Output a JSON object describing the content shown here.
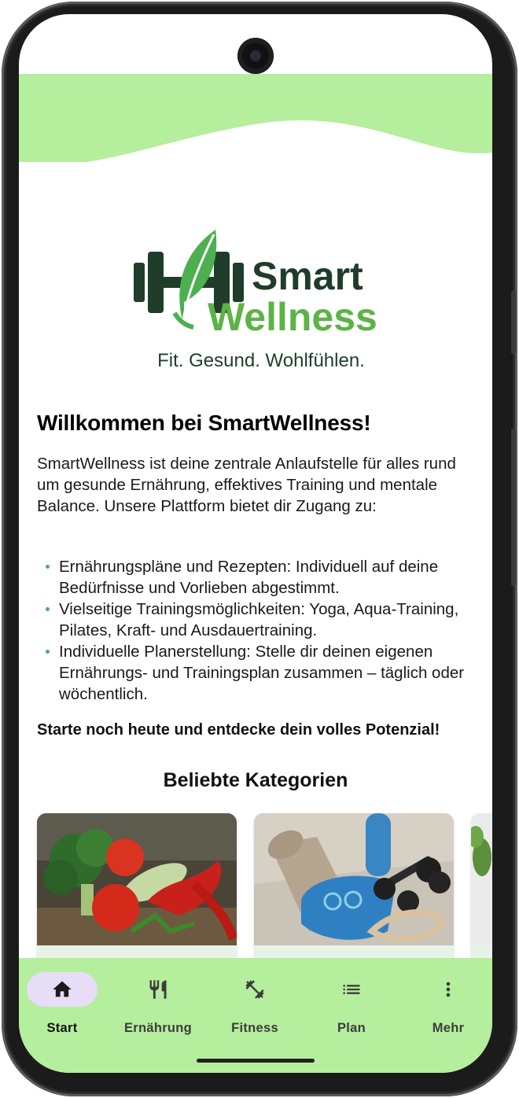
{
  "brand": {
    "name_line1": "Smart",
    "name_line2": "Wellness",
    "tagline": "Fit. Gesund. Wohlfühlen.",
    "colors": {
      "dark_green": "#1f3d2a",
      "leaf_green": "#4caf50",
      "light_green": "#b5ee9c"
    }
  },
  "welcome": {
    "title": "Willkommen bei SmartWellness!",
    "intro": "SmartWellness ist deine zentrale Anlaufstelle für alles rund um gesunde Ernährung, effektives Training und mentale Balance. Unsere Plattform bietet dir Zugang zu:",
    "bullets": [
      "Ernährungspläne und Rezepten: Individuell auf deine Bedürfnisse und Vorlieben abgestimmt.",
      "Vielseitige Trainingsmöglichkeiten: Yoga, Aqua-Training, Pilates, Kraft- und Ausdauertraining.",
      "Individuelle Planerstellung: Stelle dir deinen eigenen Ernährungs- und Trainingsplan zusammen – täglich oder wöchentlich."
    ],
    "cta": "Starte noch heute und entdecke dein volles Potenzial!"
  },
  "categories": {
    "title": "Beliebte Kategorien",
    "cards": [
      {
        "image": "vegetables-photo"
      },
      {
        "image": "fitness-equipment-photo"
      },
      {
        "image": "plant-photo"
      }
    ]
  },
  "nav": {
    "items": [
      {
        "label": "Start",
        "icon": "home-icon",
        "active": true
      },
      {
        "label": "Ernährung",
        "icon": "restaurant-icon",
        "active": false
      },
      {
        "label": "Fitness",
        "icon": "fitness-icon",
        "active": false
      },
      {
        "label": "Plan",
        "icon": "list-icon",
        "active": false
      },
      {
        "label": "Mehr",
        "icon": "more-vert-icon",
        "active": false
      }
    ]
  }
}
